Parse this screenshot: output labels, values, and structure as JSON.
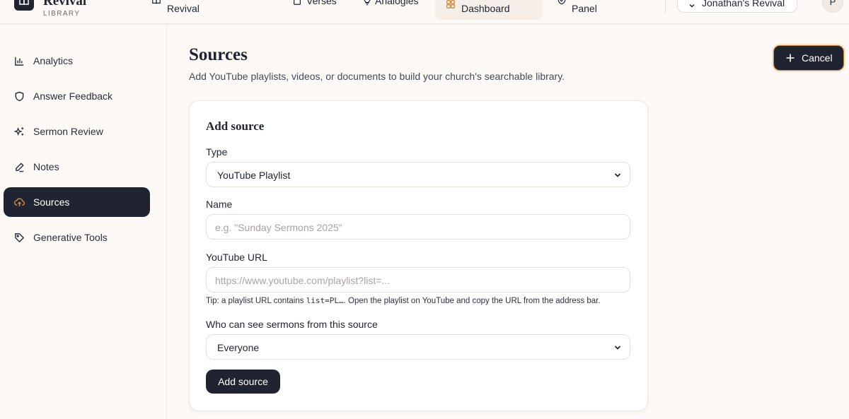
{
  "brand": {
    "name": "Revival",
    "subtitle": "LIBRARY"
  },
  "topnav": {
    "revival": "Revival",
    "verses": "Verses",
    "analogies": "Analogies",
    "dashboard": "Dashboard",
    "panel": "Panel",
    "workspace": "Jonathan's Revival",
    "avatar_initial": "P"
  },
  "sidebar": {
    "items": [
      {
        "label": "Analytics",
        "icon": "bar-chart-icon"
      },
      {
        "label": "Answer Feedback",
        "icon": "shield-icon"
      },
      {
        "label": "Sermon Review",
        "icon": "sparkles-icon"
      },
      {
        "label": "Notes",
        "icon": "pencil-icon"
      },
      {
        "label": "Sources",
        "icon": "cloud-upload-icon",
        "active": true
      },
      {
        "label": "Generative Tools",
        "icon": "tag-icon"
      }
    ]
  },
  "page": {
    "title": "Sources",
    "subtitle": "Add YouTube playlists, videos, or documents to build your church's searchable library.",
    "cancel_label": "Cancel"
  },
  "form": {
    "title": "Add source",
    "type_label": "Type",
    "type_value": "YouTube Playlist",
    "name_label": "Name",
    "name_placeholder": "e.g. \"Sunday Sermons 2025\"",
    "url_label": "YouTube URL",
    "url_placeholder": "https://www.youtube.com/playlist?list=...",
    "tip_prefix": "Tip: a playlist URL contains ",
    "tip_code": "list=PL…",
    "tip_suffix": ". Open the playlist on YouTube and copy the URL from the address bar.",
    "visibility_label": "Who can see sermons from this source",
    "visibility_value": "Everyone",
    "submit_label": "Add source"
  },
  "colors": {
    "primary_dark": "#1f2430",
    "accent_orange": "#c9832f",
    "background": "#fdf9f6"
  }
}
